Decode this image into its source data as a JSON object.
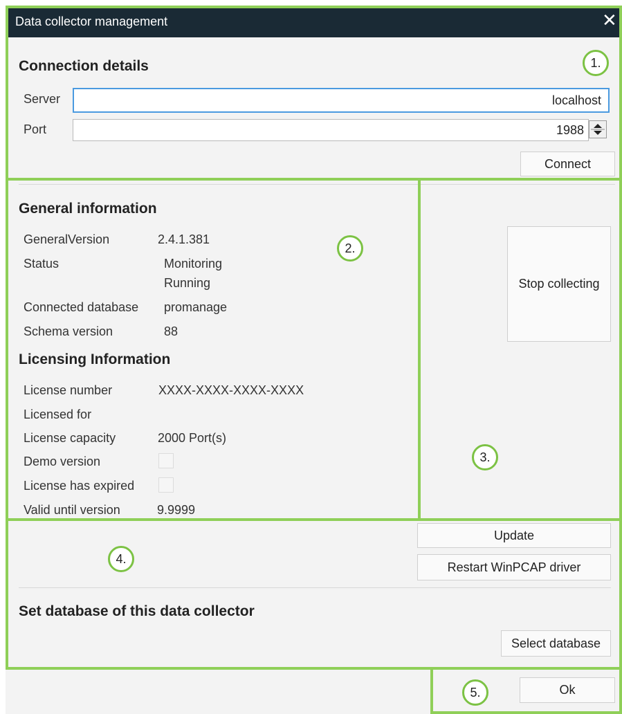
{
  "window": {
    "title": "Data collector management",
    "close_glyph": "✕"
  },
  "connection": {
    "heading": "Connection details",
    "server_label": "Server",
    "server_value": "localhost",
    "port_label": "Port",
    "port_value": "1988",
    "connect_label": "Connect"
  },
  "general": {
    "heading": "General information",
    "rows": [
      {
        "label": "GeneralVersion",
        "value": "2.4.1.381"
      },
      {
        "label": "Status",
        "value": "Monitoring",
        "value2": "Running"
      },
      {
        "label": "Connected database",
        "value": "promanage"
      },
      {
        "label": "Schema version",
        "value": "88"
      }
    ]
  },
  "licensing": {
    "heading": "Licensing Information",
    "rows": [
      {
        "label": "License number",
        "value": "XXXX-XXXX-XXXX-XXXX"
      },
      {
        "label": "Licensed for",
        "value": ""
      },
      {
        "label": "License capacity",
        "value": "2000 Port(s)"
      },
      {
        "label": "Demo version",
        "checked": false
      },
      {
        "label": "License has expired",
        "checked": false
      },
      {
        "label": "Valid until version",
        "value": "9.9999"
      }
    ]
  },
  "actions": {
    "stop_label": "Stop collecting",
    "update_label": "Update",
    "restart_label": "Restart WinPCAP driver"
  },
  "database": {
    "heading": "Set database of this data collector",
    "select_label": "Select database"
  },
  "footer": {
    "ok_label": "Ok"
  },
  "markers": [
    "1.",
    "2.",
    "3.",
    "4.",
    "5."
  ],
  "colors": {
    "titlebar": "#1a2a35",
    "frame": "#8fcf58",
    "focus": "#4a9ae0"
  },
  "icons": {
    "close": "close-icon",
    "spinner": "spinner-arrows-icon"
  }
}
